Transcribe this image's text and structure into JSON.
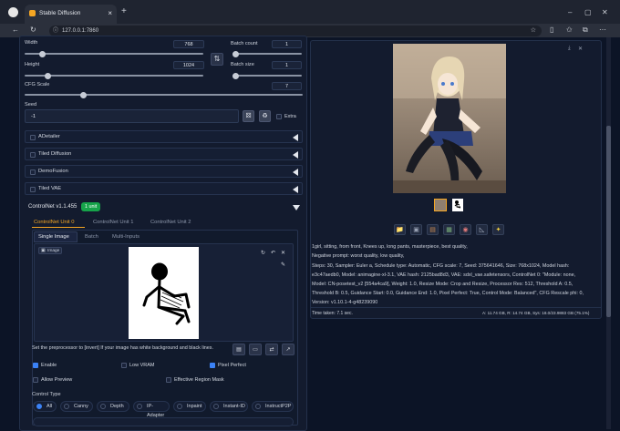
{
  "browser": {
    "tab_title": "Stable Diffusion",
    "url": "127.0.0.1:7860",
    "new_tab": "+",
    "tab_close": "×"
  },
  "settings": {
    "width_label": "Width",
    "width_value": "768",
    "height_label": "Height",
    "height_value": "1024",
    "swap_label": "⇅",
    "batch_count_label": "Batch count",
    "batch_count_value": "1",
    "batch_size_label": "Batch size",
    "batch_size_value": "1",
    "cfg_label": "CFG Scale",
    "cfg_value": "7",
    "seed_label": "Seed",
    "seed_value": "-1",
    "extra_label": "Extra"
  },
  "accordions": [
    "ADetailer",
    "Tiled Diffusion",
    "DemoFusion",
    "Tiled VAE"
  ],
  "controlnet": {
    "title": "ControlNet v1.1.455",
    "badge": "1 unit",
    "units": [
      "ControlNet Unit 0",
      "ControlNet Unit 1",
      "ControlNet Unit 2"
    ],
    "subtabs": [
      "Single Image",
      "Batch",
      "Multi-Inputs"
    ],
    "image_label": "Image",
    "hint": "Set the preprocessor to [invert] If your image has white background and black lines.",
    "enable": "Enable",
    "low_vram": "Low VRAM",
    "pixel_perfect": "Pixel Perfect",
    "allow_preview": "Allow Preview",
    "effective_region_mask": "Effective Region Mask",
    "control_type_label": "Control Type",
    "control_types": [
      "All",
      "Canny",
      "Depth",
      "IP-Adapter",
      "Inpaint",
      "Instant-ID",
      "InstructP2P"
    ]
  },
  "output": {
    "info_lines": [
      "1girl, sitting, from front, Knees up, long pants, masterpiece, best quality,",
      "Negative prompt: worst quality, low quality,",
      "Steps: 30, Sampler: Euler a, Schedule type: Automatic, CFG scale: 7, Seed: 375641646, Size: 768x1024, Model hash:",
      "e3c47aedb0, Model: animagine-xl-3.1, VAE hash: 2125bad8d3, VAE: sdxl_vae.safetensors, ControlNet 0: \"Module: none,",
      "Model: CN-posetest_v2 [554a4ca9], Weight: 1.0, Resize Mode: Crop and Resize, Processor Res: 512, Threshold A: 0.5,",
      "Threshold B: 0.5, Guidance Start: 0.0, Guidance End: 1.0, Pixel Perfect: True, Control Mode: Balanced\", CFG Rescale phi: 0,",
      "Version: v1.10.1-4-g48239090"
    ],
    "time_taken": "Time taken: 7.1 sec.",
    "vram": "A: 11.74 GB, R: 14.74 GB, Sys: 18.0/23.9883 GB (75.1%)"
  },
  "colors": {
    "accent": "#f5a623",
    "green_badge": "#16a34a",
    "checkbox_on": "#3b82f6"
  }
}
